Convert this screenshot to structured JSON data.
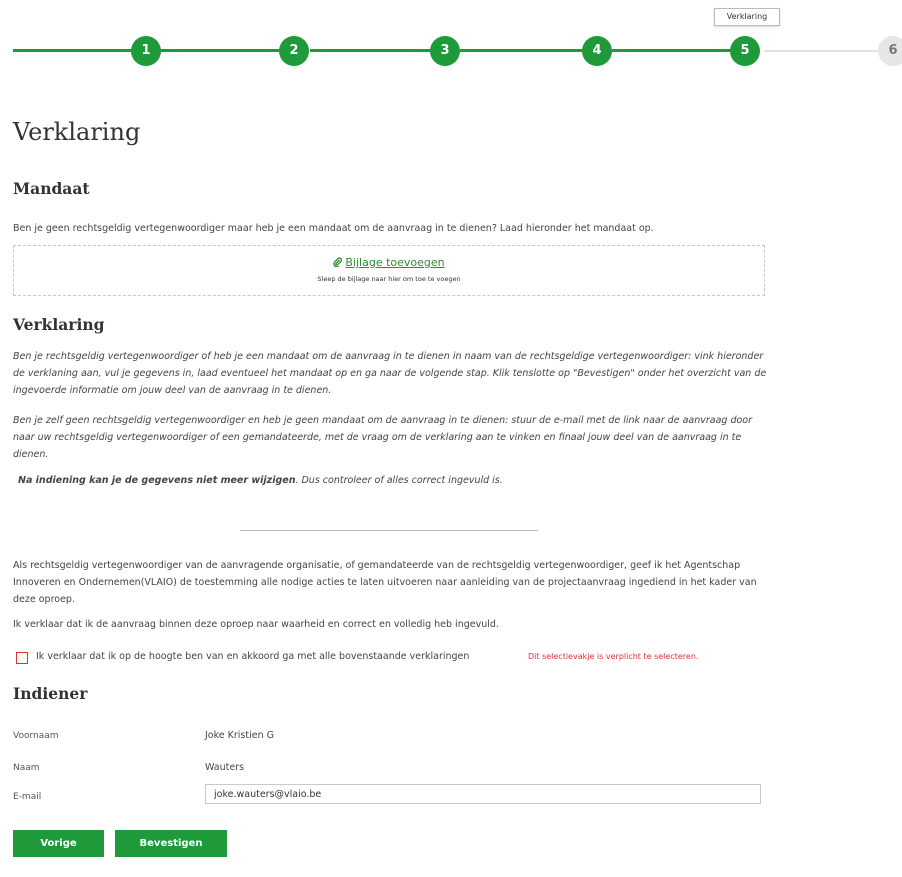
{
  "colors": {
    "accent": "#1f9a3a",
    "inactive": "#e6e6e6",
    "error": "#d33333"
  },
  "stepper": {
    "steps": [
      "1",
      "2",
      "3",
      "4",
      "5",
      "6"
    ],
    "active_step": 5,
    "tooltip": "Verklaring"
  },
  "page_title": "Verklaring",
  "mandaat": {
    "heading": "Mandaat",
    "intro": "Ben je geen rechtsgeldig vertegenwoordiger maar heb je een mandaat om de aanvraag in te dienen? Laad hieronder het mandaat op.",
    "attach_icon": "paperclip-icon",
    "attach_link": "Bijlage toevoegen",
    "attach_hint": "Sleep de bijlage naar hier om toe te voegen"
  },
  "verklaring": {
    "heading": "Verklaring",
    "para1": "Ben je rechtsgeldig vertegenwoordiger of heb je een mandaat om de aanvraag in te dienen in naam van de rechtsgeldige vertegenwoordiger: vink hieronder de verklaning aan, vul je gegevens in, laad eventueel het mandaat op en ga naar de volgende stap. Klik tenslotte op \"Bevestigen\" onder het overzicht van de ingevoerde informatie om jouw deel van de aanvraag in te dienen.",
    "para2": "Ben je zelf geen rechtsgeldig vertegenwoordiger en heb je geen mandaat om de aanvraag in te dienen: stuur de e-mail met de link naar de aanvraag door naar uw rechtsgeldig vertegenwoordiger of een gemandateerde, met de vraag om de verklaring aan te vinken en finaal jouw deel van de aanvraag in te dienen.",
    "warning_bold": "Na indiening kan je de gegevens niet meer wijzigen",
    "warning_rest": ". Dus controleer of alles correct ingevuld is.",
    "statement1": "Als rechtsgeldig vertegenwoordiger van de aanvragende organisatie, of gemandateerde van de rechtsgeldig vertegenwoordiger, geef ik het Agentschap Innoveren en Ondernemen(VLAIO) de toestemming alle nodige acties te laten uitvoeren naar aanleiding van de projectaanvraag ingediend in het kader van deze oproep.",
    "statement2": "Ik verklaar dat ik de aanvraag binnen deze oproep naar waarheid en correct en volledig heb ingevuld.",
    "checkbox_label": "Ik verklaar dat ik op de hoogte ben van en akkoord ga met alle bovenstaande verklaringen",
    "checkbox_error": "Dit selectievakje is verplicht te selecteren."
  },
  "indiener": {
    "heading": "Indiener",
    "voornaam_label": "Voornaam",
    "voornaam_value": "Joke Kristien G",
    "naam_label": "Naam",
    "naam_value": "Wauters",
    "email_label": "E-mail",
    "email_value": "joke.wauters@vlaio.be"
  },
  "buttons": {
    "back": "Vorige",
    "confirm": "Bevestigen"
  }
}
